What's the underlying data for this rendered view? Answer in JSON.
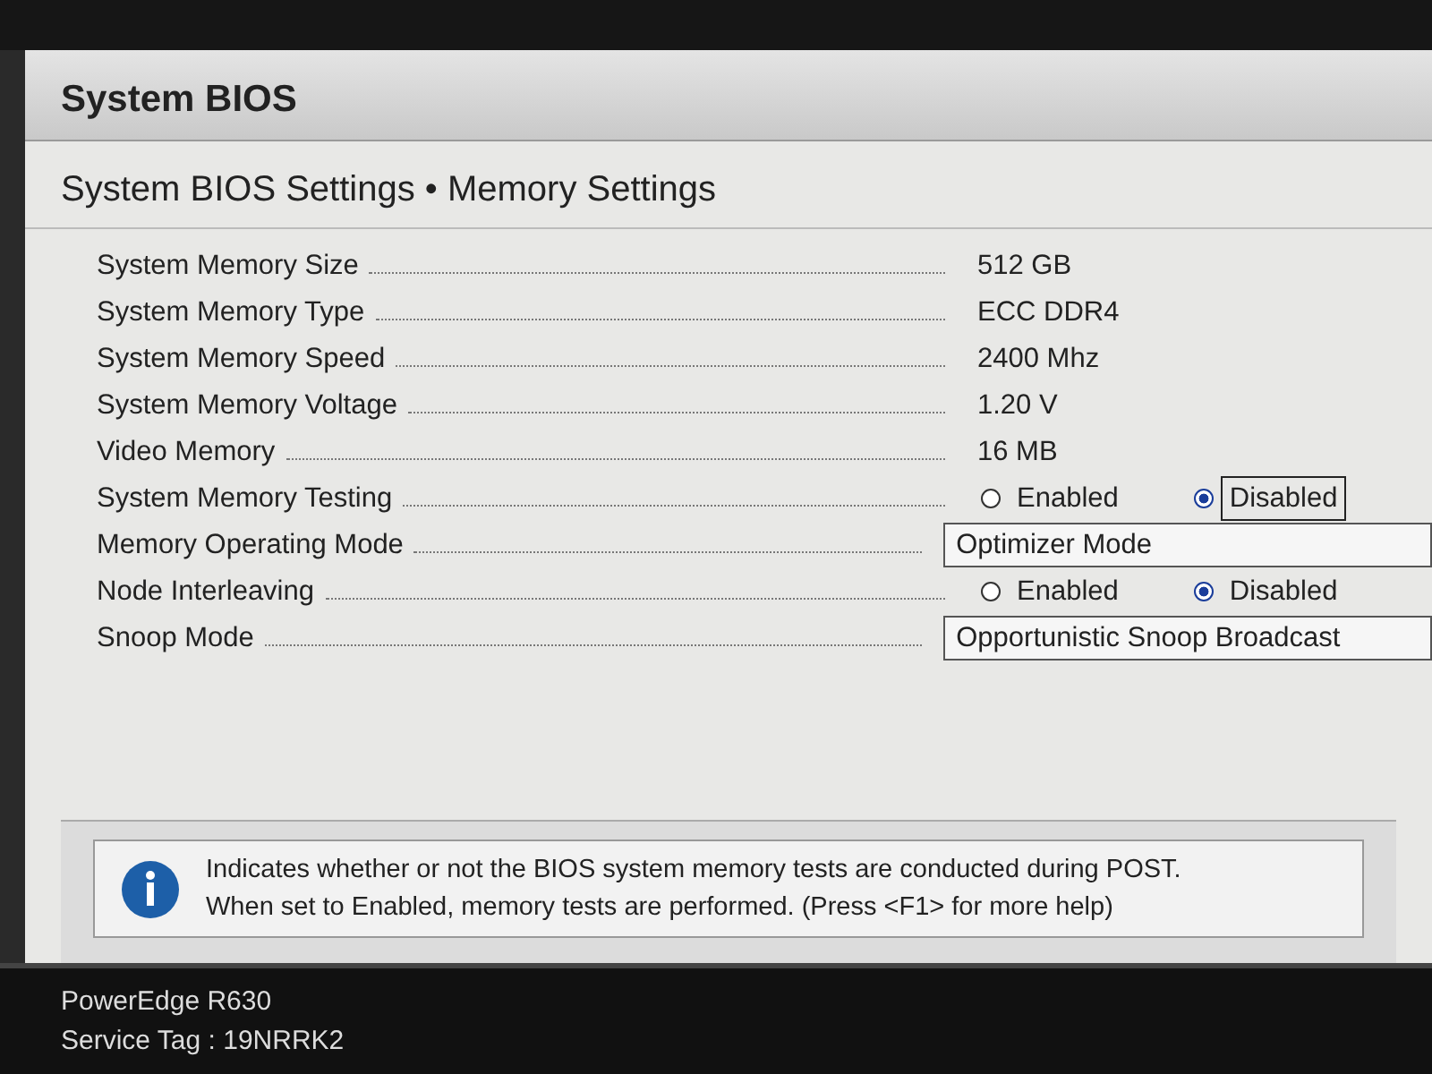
{
  "header": {
    "title": "System BIOS"
  },
  "page_title": "System BIOS Settings • Memory Settings",
  "settings": [
    {
      "label": "System Memory Size",
      "kind": "text",
      "value": "512 GB"
    },
    {
      "label": "System Memory Type",
      "kind": "text",
      "value": "ECC DDR4"
    },
    {
      "label": "System Memory Speed",
      "kind": "text",
      "value": "2400 Mhz"
    },
    {
      "label": "System Memory Voltage",
      "kind": "text",
      "value": "1.20 V"
    },
    {
      "label": "Video Memory",
      "kind": "text",
      "value": "16 MB"
    },
    {
      "label": "System Memory Testing",
      "kind": "radio",
      "options": [
        {
          "label": "Enabled",
          "selected": false,
          "focused": false
        },
        {
          "label": "Disabled",
          "selected": true,
          "focused": true
        }
      ]
    },
    {
      "label": "Memory Operating Mode",
      "kind": "dropdown",
      "value": "Optimizer Mode"
    },
    {
      "label": "Node Interleaving",
      "kind": "radio",
      "options": [
        {
          "label": "Enabled",
          "selected": false,
          "focused": false
        },
        {
          "label": "Disabled",
          "selected": true,
          "focused": false
        }
      ]
    },
    {
      "label": "Snoop Mode",
      "kind": "dropdown",
      "value": "Opportunistic Snoop Broadcast"
    }
  ],
  "help": {
    "lines": [
      "Indicates whether or not the BIOS system memory tests are conducted during POST.",
      "When set to Enabled, memory tests are performed. (Press <F1> for more help)"
    ]
  },
  "footer": {
    "model": "PowerEdge R630",
    "service_tag": "Service Tag : 19NRRK2"
  }
}
